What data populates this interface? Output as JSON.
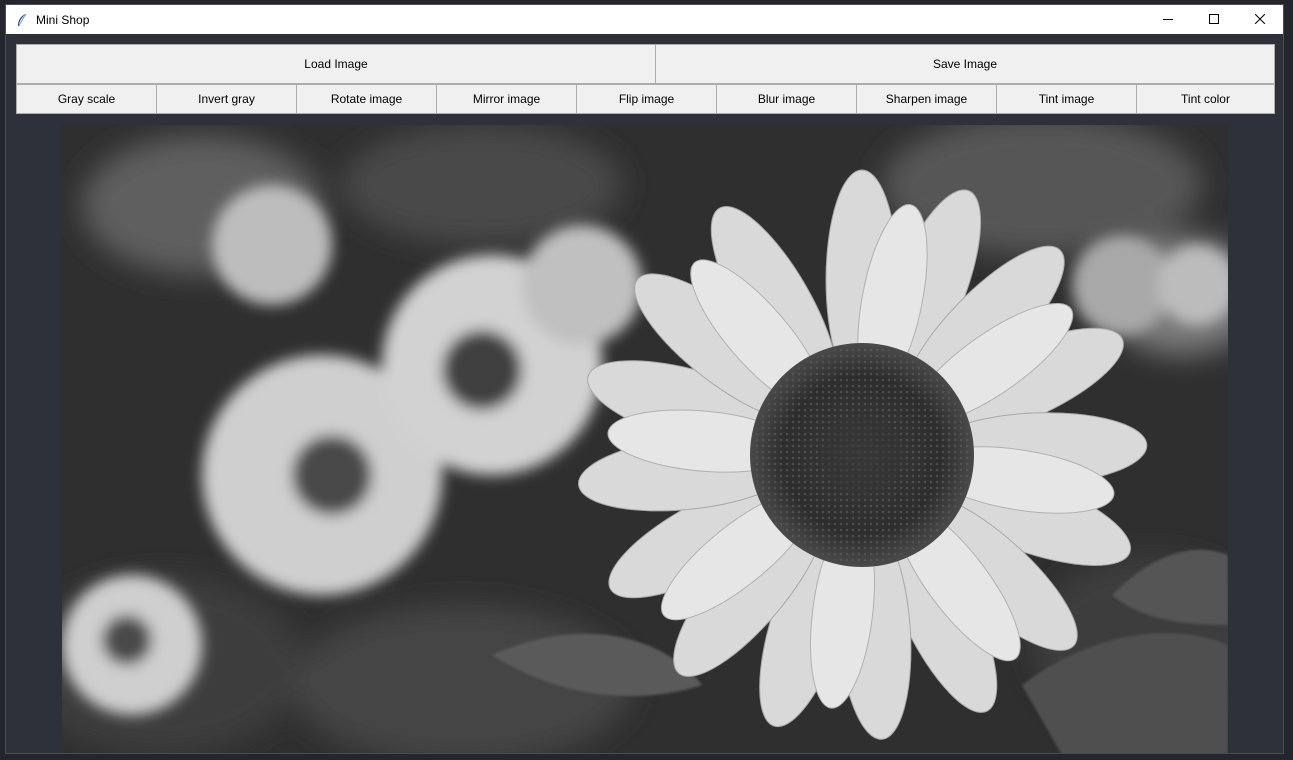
{
  "window": {
    "title": "Mini Shop",
    "controls": {
      "minimize": "minimize-icon",
      "maximize": "maximize-icon",
      "close": "close-icon"
    }
  },
  "file_bar": {
    "load_label": "Load Image",
    "save_label": "Save Image"
  },
  "tools": [
    {
      "label": "Gray scale"
    },
    {
      "label": "Invert gray"
    },
    {
      "label": "Rotate image"
    },
    {
      "label": "Mirror image"
    },
    {
      "label": "Flip image"
    },
    {
      "label": "Blur image"
    },
    {
      "label": "Sharpen image"
    },
    {
      "label": "Tint image"
    },
    {
      "label": "Tint color"
    }
  ],
  "colors": {
    "window_bg": "#2e313a",
    "button_bg": "#f0f0f0",
    "button_border": "#adadad"
  },
  "canvas": {
    "content": "grayscale sunflower photo"
  }
}
